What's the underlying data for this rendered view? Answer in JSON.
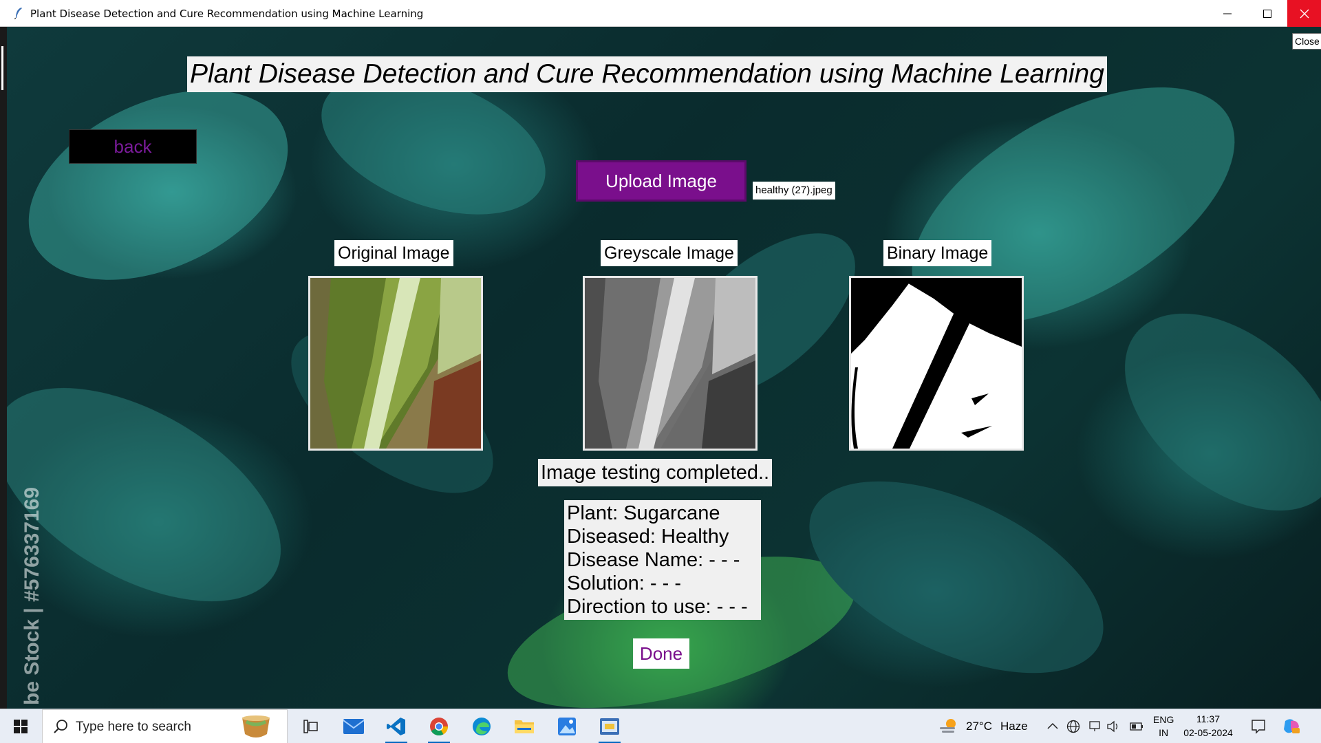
{
  "window": {
    "title": "Plant Disease Detection and Cure Recommendation using Machine Learning"
  },
  "app": {
    "heading": "Plant Disease Detection and Cure Recommendation using Machine Learning",
    "back_label": "back",
    "upload_label": "Upload Image",
    "filename": "healthy (27).jpeg",
    "close_label": "Close",
    "images": [
      {
        "label": "Original Image",
        "kind": "original"
      },
      {
        "label": "Greyscale Image",
        "kind": "greyscale"
      },
      {
        "label": "Binary Image",
        "kind": "binary"
      }
    ],
    "status": "Image testing completed..",
    "results": {
      "plant": "Plant: Sugarcane",
      "diseased": "Diseased: Healthy",
      "disease_name": "Disease Name: - - -",
      "solution": "Solution: - - -",
      "direction": "Direction to use: - - -"
    },
    "done_label": "Done",
    "background_watermark": "be Stock | #576337169"
  },
  "taskbar": {
    "search_placeholder": "Type here to search",
    "weather_temp": "27°C",
    "weather_desc": "Haze",
    "lang_line1": "ENG",
    "lang_line2": "IN",
    "time": "11:37",
    "date": "02-05-2024"
  },
  "colors": {
    "upload_bg": "#7a0f8c",
    "back_text": "#7a1b9a",
    "done_text": "#7a0f8c",
    "close_red": "#e81123"
  }
}
